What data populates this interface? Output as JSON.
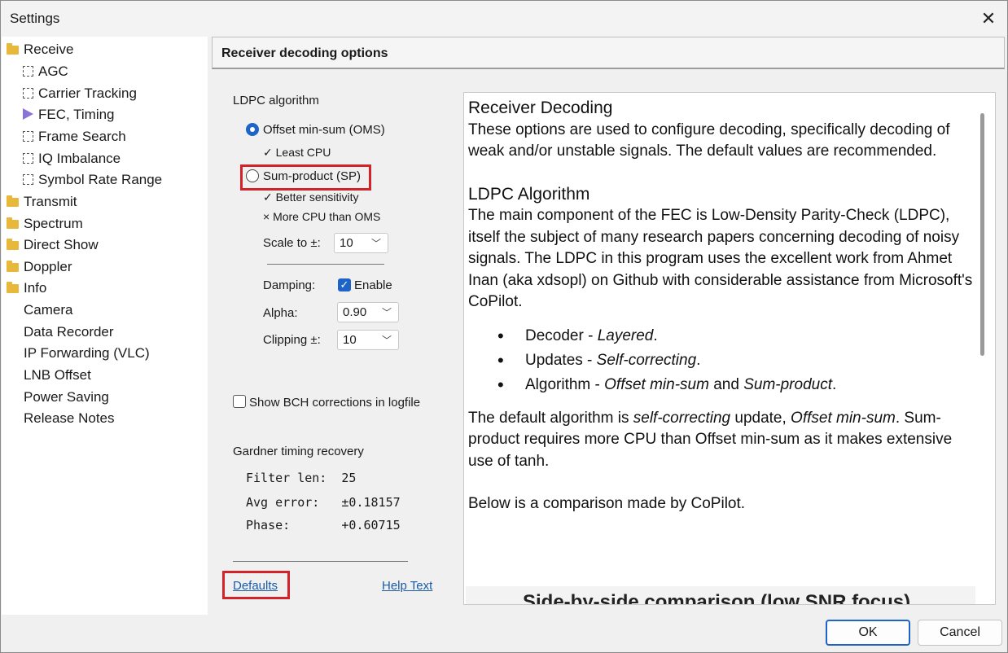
{
  "window": {
    "title": "Settings"
  },
  "tree": {
    "items": [
      {
        "label": "Receive",
        "icon": "folder-icon"
      },
      {
        "label": "AGC",
        "icon": "page-icon"
      },
      {
        "label": "Carrier Tracking",
        "icon": "page-icon"
      },
      {
        "label": "FEC, Timing",
        "icon": "selected-arrow-icon"
      },
      {
        "label": "Frame Search",
        "icon": "page-icon"
      },
      {
        "label": "IQ Imbalance",
        "icon": "page-icon"
      },
      {
        "label": "Symbol Rate Range",
        "icon": "page-icon"
      },
      {
        "label": "Transmit",
        "icon": "folder-icon"
      },
      {
        "label": "Spectrum",
        "icon": "folder-icon"
      },
      {
        "label": "Direct Show",
        "icon": "folder-icon"
      },
      {
        "label": "Doppler",
        "icon": "folder-icon"
      },
      {
        "label": "Info",
        "icon": "folder-icon"
      },
      {
        "label": "Camera",
        "icon": ""
      },
      {
        "label": "Data Recorder",
        "icon": ""
      },
      {
        "label": "IP Forwarding (VLC)",
        "icon": ""
      },
      {
        "label": "LNB Offset",
        "icon": ""
      },
      {
        "label": "Power Saving",
        "icon": ""
      },
      {
        "label": "Release Notes",
        "icon": ""
      }
    ]
  },
  "panel": {
    "header": "Receiver decoding options",
    "ldpc": {
      "group_label": "LDPC algorithm",
      "oms_label": "Offset min-sum (OMS)",
      "oms_note": "✓ Least CPU",
      "sp_label": "Sum-product (SP)",
      "sp_note1": "✓ Better sensitivity",
      "sp_note2": "× More CPU than OMS",
      "scale_label": "Scale to ±:",
      "scale_value": "10",
      "damping_label": "Damping:",
      "enable_label": "Enable",
      "alpha_label": "Alpha:",
      "alpha_value": "0.90",
      "clipping_label": "Clipping ±:",
      "clipping_value": "10"
    },
    "bch_label": "Show BCH corrections in logfile",
    "gardner": {
      "group_label": "Gardner timing recovery",
      "filter_line": "Filter len:  25",
      "avg_line": "Avg error:   ±0.18157",
      "phase_line": "Phase:       +0.60715"
    },
    "defaults_link": "Defaults",
    "help_link": "Help Text"
  },
  "help": {
    "h1": "Receiver Decoding",
    "p1": "These options are used to configure decoding, specifically decoding of weak and/or unstable signals. The default values are recommended.",
    "h2": "LDPC Algorithm",
    "p2": "The main component of the FEC is Low-Density Parity-Check (LDPC), itself the subject of many research papers concerning decoding of noisy signals. The LDPC in this program uses the excellent work from Ahmet Inan (aka xdsopl) on Github with considerable assistance from Microsoft's CoPilot.",
    "b1_label": "Decoder - ",
    "b1_value": "Layered",
    "b2_label": "Updates - ",
    "b2_value": "Self-correcting",
    "b3_label": "Algorithm - ",
    "b3_value1": "Offset min-sum",
    "b3_and": " and ",
    "b3_value2": "Sum-product",
    "p3_a": "The default algorithm is ",
    "p3_b": "self-correcting",
    "p3_c": " update, ",
    "p3_d": "Offset min-sum",
    "p3_e": ". Sum-product requires more CPU than Offset min-sum as it makes extensive use of tanh.",
    "p4": "Below is a comparison made by CoPilot.",
    "cut_heading": "Side-by-side comparison (low SNR focus)"
  },
  "buttons": {
    "ok": "OK",
    "cancel": "Cancel"
  }
}
